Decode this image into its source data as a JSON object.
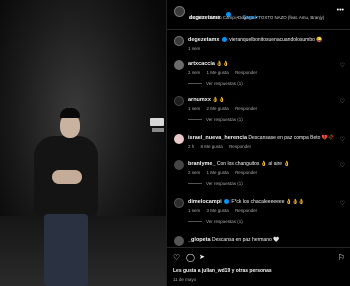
{
  "post": {
    "author": "degezetamx",
    "follow_label": "Seguir",
    "subtitle": "Jacobbo, Dimelo Campi, Degzeta • TOXTO NAZO (feat. Amu, Branjy)",
    "dot": "•"
  },
  "caption": {
    "author": "degezetamx",
    "text": "vieranquelbonitosuenacuandolosumbo",
    "emoji": "😜",
    "time": "1 sem"
  },
  "comments": [
    {
      "user": "artxcaccia",
      "text": "👌👌",
      "time": "2 sem",
      "likes": "1 Me gusta",
      "reply": "Responder",
      "replies": "Ver respuestas (1)",
      "avatar_color": "#6b6b6b"
    },
    {
      "user": "arnumxx",
      "text": "👌👌",
      "time": "1 sem",
      "likes": "2 Me gusta",
      "reply": "Responder",
      "replies": "Ver respuestas (1)",
      "avatar_color": "#1f1f1f"
    },
    {
      "user": "israel_nueva_herencia",
      "text": "Descansase en paz compa Beto 💔🥀",
      "time": "2 h",
      "likes": "8 Me gusta",
      "reply": "Responder",
      "replies": "",
      "avatar_color": "#e8c8c8"
    },
    {
      "user": "branlyme_",
      "text": "Con los changuitos 👌 al aire 👌",
      "time": "2 sem",
      "likes": "1 Me gusta",
      "reply": "Responder",
      "replies": "Ver respuestas (1)",
      "avatar_color": "#444444"
    },
    {
      "user": "dimelocampi",
      "text": "F*ck los chacaleeeeeee 👌👌👌",
      "time": "1 sem",
      "likes": "3 Me gusta",
      "reply": "Responder",
      "replies": "Ver respuestas (1)",
      "avatar_color": "#2c2c2c"
    },
    {
      "user": "_glopeta",
      "text": "Descansa en paz hermano 🤍",
      "time": "",
      "likes": "",
      "reply": "",
      "replies": "",
      "avatar_color": "#555555"
    }
  ],
  "footer": {
    "likes_text": "Les gusta a julian_wd19 y otras personas",
    "date": "11 de mayo"
  },
  "icons": {
    "heart": "heart-icon",
    "comment": "comment-icon",
    "share": "share-icon",
    "save": "bookmark-icon"
  },
  "colors": {
    "accent": "#0095f6",
    "background": "#000000",
    "muted": "#a8a8a8"
  }
}
